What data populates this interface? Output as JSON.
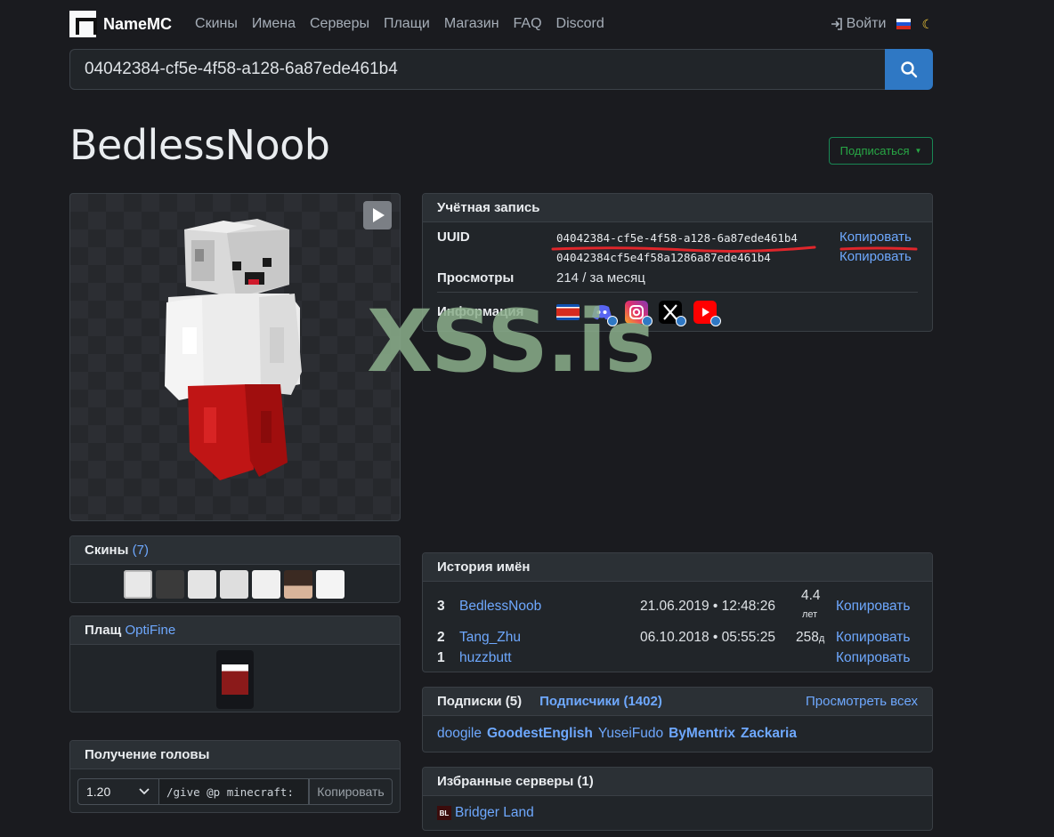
{
  "nav": {
    "brand": "NameMC",
    "links": [
      "Скины",
      "Имена",
      "Серверы",
      "Плащи",
      "Магазин",
      "FAQ",
      "Discord"
    ],
    "login": "Войти"
  },
  "search": {
    "value": "04042384-cf5e-4f58-a128-6a87ede461b4"
  },
  "profile": {
    "name": "BedlessNoob",
    "subscribe_label": "Подписаться"
  },
  "account": {
    "title": "Учётная запись",
    "uuid_label": "UUID",
    "uuid": "04042384-cf5e-4f58-a128-6a87ede461b4",
    "uuid_plain": "04042384cf5e4f58a1286a87ede461b4",
    "copy_label": "Копировать",
    "views_label": "Просмотры",
    "views_value": "214 / за месяц",
    "info_label": "Информация"
  },
  "watermark": "XSS.is",
  "skins": {
    "title": "Скины",
    "count": "(7)"
  },
  "cape": {
    "title": "Плащ",
    "type": "OptiFine"
  },
  "head": {
    "title": "Получение головы",
    "version": "1.20",
    "command": "/give @p minecraft:",
    "copy_label": "Копировать"
  },
  "history": {
    "title": "История имён",
    "copy_label": "Копировать",
    "rows": [
      {
        "num": "3",
        "name": "BedlessNoob",
        "date": "21.06.2019 • 12:48:26",
        "age": "4.4",
        "age_unit": "лет"
      },
      {
        "num": "2",
        "name": "Tang_Zhu",
        "date": "06.10.2018 • 05:55:25",
        "age": "258",
        "age_unit": "д"
      },
      {
        "num": "1",
        "name": "huzzbutt",
        "date": "",
        "age": "",
        "age_unit": ""
      }
    ]
  },
  "follows": {
    "following_label": "Подписки (5)",
    "followers_label": "Подписчики (1402)",
    "view_all": "Просмотреть всех",
    "names": [
      "doogile",
      "GoodestEnglish",
      "YuseiFudo",
      "ByMentrix",
      "Zackaria"
    ]
  },
  "servers": {
    "title": "Избранные серверы (1)",
    "name": "Bridger Land",
    "icon_text": "BL"
  },
  "colors": {
    "accent": "#6ea8fe",
    "search_button": "#2f78c4",
    "underline": "#e0262b",
    "subscribe": "#28a745"
  }
}
